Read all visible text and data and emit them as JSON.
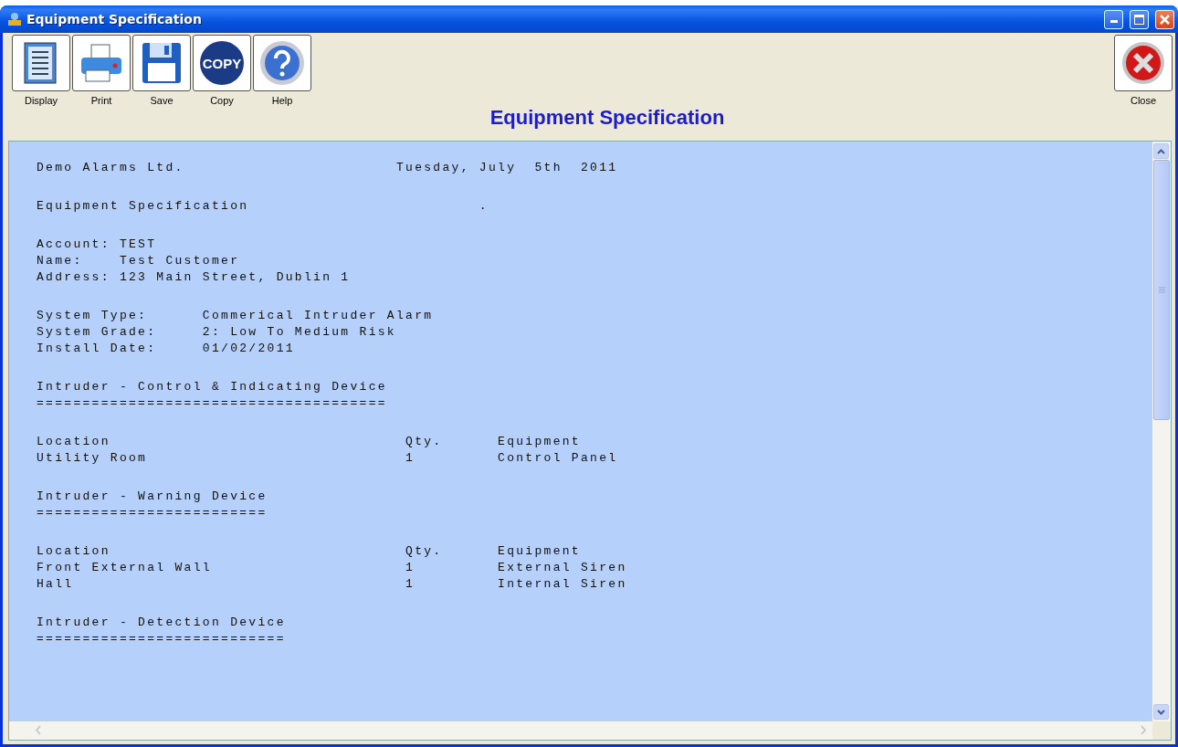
{
  "window": {
    "title": "Equipment Specification"
  },
  "toolbar": [
    {
      "kind": "display",
      "label": "Display"
    },
    {
      "kind": "print",
      "label": "Print"
    },
    {
      "kind": "save",
      "label": "Save"
    },
    {
      "kind": "copy",
      "label": "Copy",
      "icon_text": "COPY"
    },
    {
      "kind": "help",
      "label": "Help"
    }
  ],
  "close_button": {
    "label": "Close"
  },
  "heading": "Equipment Specification",
  "report": {
    "sections": [
      [
        "Demo Alarms Ltd.                       Tuesday, July  5th  2011"
      ],
      [
        "Equipment Specification                         ."
      ],
      [
        "Account: TEST",
        "Name:    Test Customer",
        "Address: 123 Main Street, Dublin 1"
      ],
      [
        "System Type:      Commerical Intruder Alarm",
        "System Grade:     2: Low To Medium Risk",
        "Install Date:     01/02/2011"
      ],
      [
        "Intruder - Control & Indicating Device",
        "======================================"
      ],
      [
        "Location                                Qty.      Equipment",
        "Utility Room                            1         Control Panel"
      ],
      [
        "Intruder - Warning Device",
        "========================="
      ],
      [
        "Location                                Qty.      Equipment",
        "Front External Wall                     1         External Siren",
        "Hall                                    1         Internal Siren"
      ],
      [
        "Intruder - Detection Device",
        "==========================="
      ]
    ]
  }
}
